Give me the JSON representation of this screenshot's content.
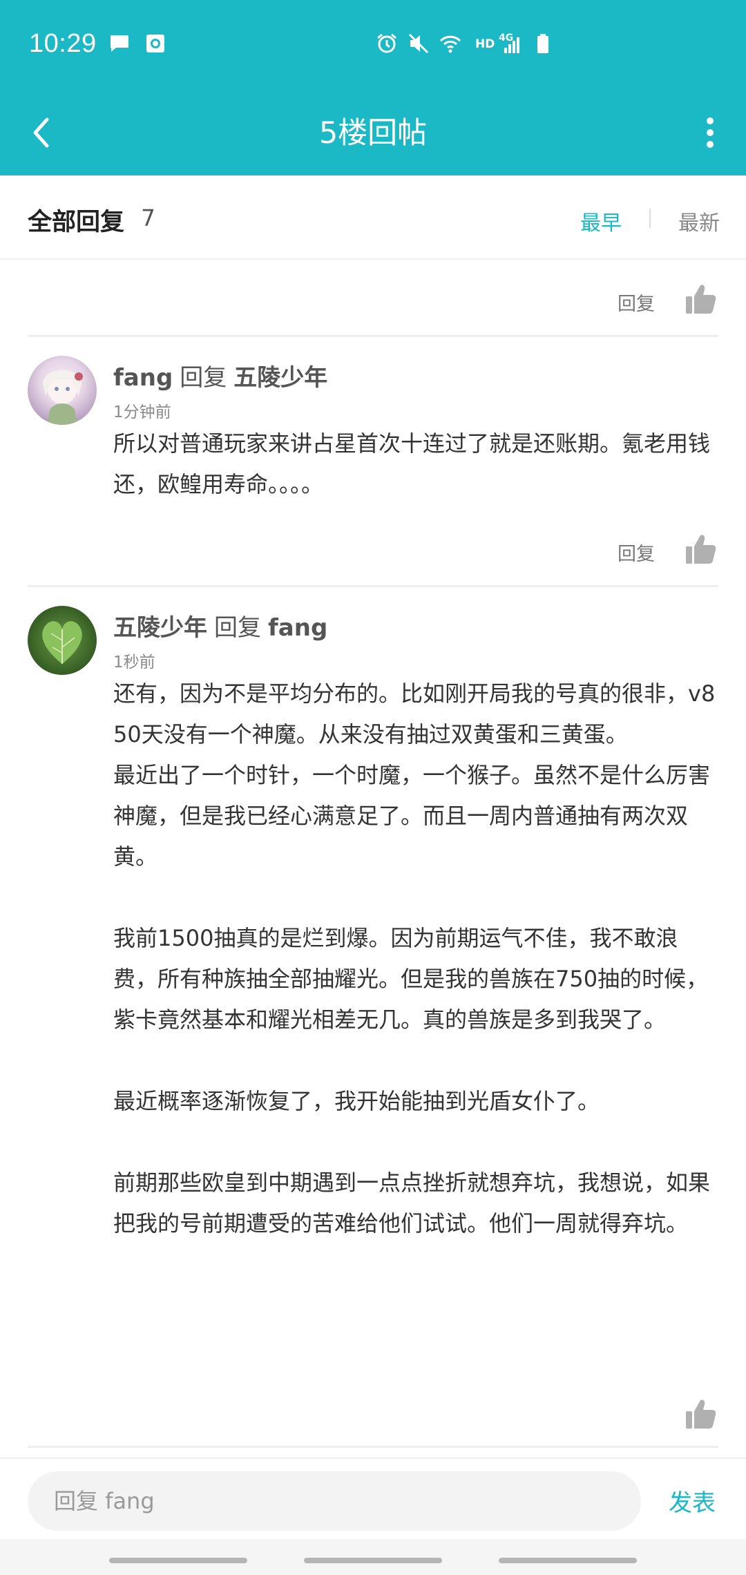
{
  "colors": {
    "accent": "#1bb8c6",
    "background": "#ffffff",
    "muted_text": "#888888"
  },
  "status_bar": {
    "time": "10:29",
    "icons": [
      "message-icon",
      "screen-record-icon",
      "alarm-icon",
      "mute-icon",
      "wifi-icon",
      "hd-badge",
      "signal-4g-icon",
      "battery-icon"
    ],
    "hd_label": "HD",
    "network_label": "4G"
  },
  "header": {
    "title": "5楼回帖",
    "back_icon": "chevron-left-icon",
    "more_icon": "more-vertical-icon"
  },
  "sort": {
    "title": "全部回复",
    "count": "7",
    "earliest": "最早",
    "latest": "最新"
  },
  "reply_label": "回复",
  "comments": [
    {
      "author": "fang",
      "verb": "回复",
      "target": "五陵少年",
      "time": "1分钟前",
      "paragraphs": [
        "所以对普通玩家来讲占星首次十连过了就是还账期。氪老用钱还，欧鳇用寿命。。。。"
      ]
    },
    {
      "author": "五陵少年",
      "verb": "回复",
      "target": "fang",
      "time": "1秒前",
      "paragraphs": [
        "还有，因为不是平均分布的。比如刚开局我的号真的很非，v8 50天没有一个神魔。从来没有抽过双黄蛋和三黄蛋。\n最近出了一个时针，一个时魔，一个猴子。虽然不是什么厉害神魔，但是我已经心满意足了。而且一周内普通抽有两次双黄。",
        "我前1500抽真的是烂到爆。因为前期运气不佳，我不敢浪费，所有种族抽全部抽耀光。但是我的兽族在750抽的时候，紫卡竟然基本和耀光相差无几。真的兽族是多到我哭了。",
        "最近概率逐渐恢复了，我开始能抽到光盾女仆了。",
        "前期那些欧皇到中期遇到一点点挫折就想弃坑，我想说，如果把我的号前期遭受的苦难给他们试试。他们一周就得弃坑。"
      ]
    }
  ],
  "composer": {
    "placeholder": "回复 fang",
    "send_label": "发表"
  }
}
